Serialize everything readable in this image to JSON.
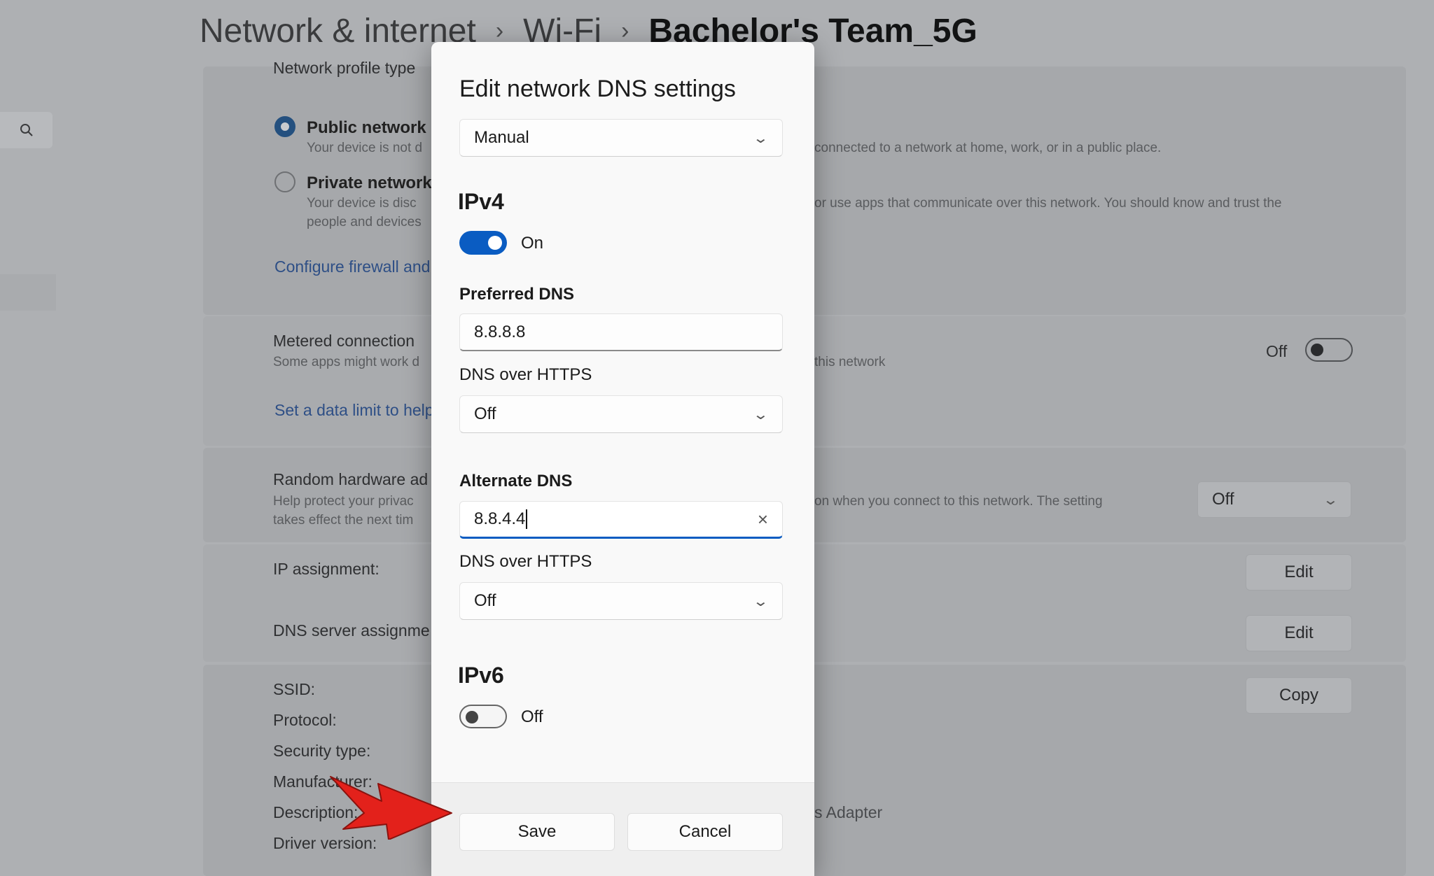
{
  "breadcrumb": {
    "level1": "Network & internet",
    "sep1": "›",
    "level2": "Wi-Fi",
    "sep2": "›",
    "current": "Bachelor's Team_5G"
  },
  "background": {
    "profile_heading": "Network profile type",
    "public": {
      "title": "Public network (",
      "desc": "Your device is not d"
    },
    "private": {
      "title": "Private network",
      "desc1": "Your device is disc",
      "desc2": "people and devices"
    },
    "profile_right1": "connected to a network at home, work, or in a public place.",
    "profile_right2": "or use apps that communicate over this network. You should know and trust the",
    "firewall_link": "Configure firewall and",
    "metered": {
      "title": "Metered connection",
      "desc": "Some apps might work d",
      "right_desc": "this network",
      "toggle_label": "Off"
    },
    "data_limit_link": "Set a data limit to help",
    "random_hw": {
      "title": "Random hardware ad",
      "desc1": "Help protect your privac",
      "desc2": "takes effect the next tim",
      "right_desc": "on when you connect to this network. The setting",
      "select_value": "Off"
    },
    "ip_assignment": {
      "label": "IP assignment:",
      "button": "Edit"
    },
    "dns_assignment": {
      "label": "DNS server assignme",
      "button": "Edit"
    },
    "properties": {
      "ssid": "SSID:",
      "protocol": "Protocol:",
      "security": "Security type:",
      "manufacturer": "Manufacturer:",
      "description": "Description:",
      "description_value": "s Adapter",
      "driver": "Driver version:",
      "copy_button": "Copy"
    }
  },
  "dialog": {
    "title": "Edit network DNS settings",
    "mode_select": "Manual",
    "ipv4": {
      "heading": "IPv4",
      "toggle_label": "On",
      "toggle_on": true,
      "preferred_label": "Preferred DNS",
      "preferred_value": "8.8.8.8",
      "preferred_doh_label": "DNS over HTTPS",
      "preferred_doh_value": "Off",
      "alternate_label": "Alternate DNS",
      "alternate_value": "8.8.4.4",
      "alternate_doh_label": "DNS over HTTPS",
      "alternate_doh_value": "Off"
    },
    "ipv6": {
      "heading": "IPv6",
      "toggle_label": "Off",
      "toggle_on": false
    },
    "save": "Save",
    "cancel": "Cancel"
  },
  "colors": {
    "accent": "#0a5cc2",
    "arrow": "#e3211b",
    "overlay": "#aeb0b3"
  },
  "icons": {
    "search": "search-icon",
    "chevron": "chevron-down-icon",
    "clear": "clear-icon",
    "pointer": "red-arrow-annotation"
  }
}
